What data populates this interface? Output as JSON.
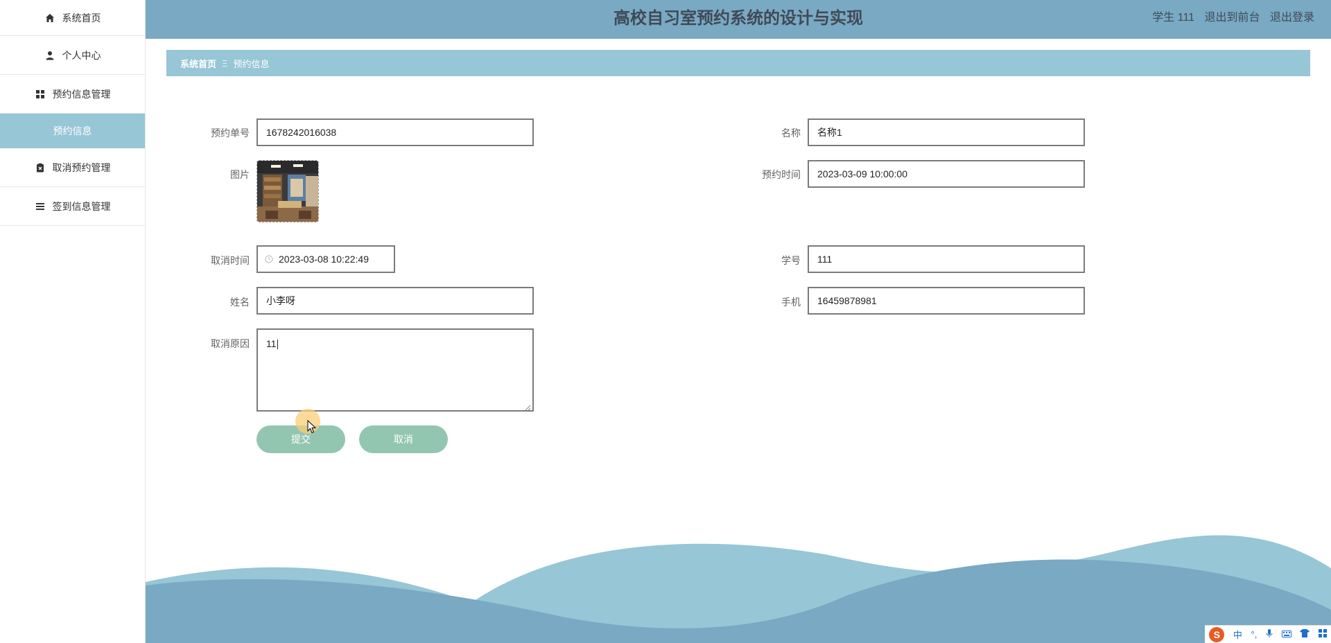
{
  "app": {
    "title": "高校自习室预约系统的设计与实现",
    "user": "学生 111",
    "back_to_front": "退出到前台",
    "logout": "退出登录"
  },
  "sidebar": {
    "items": [
      {
        "label": "系统首页",
        "icon": "home-icon"
      },
      {
        "label": "个人中心",
        "icon": "user-icon"
      },
      {
        "label": "预约信息管理",
        "icon": "grid-icon"
      },
      {
        "label": "预约信息",
        "icon": ""
      },
      {
        "label": "取消预约管理",
        "icon": "clipboard-x-icon"
      },
      {
        "label": "签到信息管理",
        "icon": "list-icon"
      }
    ]
  },
  "breadcrumb": {
    "home": "系统首页",
    "separator": "Ξ",
    "current": "预约信息"
  },
  "form": {
    "order_no_label": "预约单号",
    "order_no": "1678242016038",
    "name_label": "名称",
    "name": "名称1",
    "image_label": "图片",
    "reserve_time_label": "预约时间",
    "reserve_time": "2023-03-09 10:00:00",
    "cancel_time_label": "取消时间",
    "cancel_time": "2023-03-08 10:22:49",
    "student_no_label": "学号",
    "student_no": "111",
    "student_name_label": "姓名",
    "student_name": "小李呀",
    "phone_label": "手机",
    "phone": "16459878981",
    "cancel_reason_label": "取消原因",
    "cancel_reason": "11",
    "submit_label": "提交",
    "cancel_label": "取消"
  },
  "ime": {
    "logo": "S",
    "mode": "中"
  },
  "colors": {
    "header": "#79a9c3",
    "accent": "#97c6d6",
    "button": "#93c6b1"
  }
}
